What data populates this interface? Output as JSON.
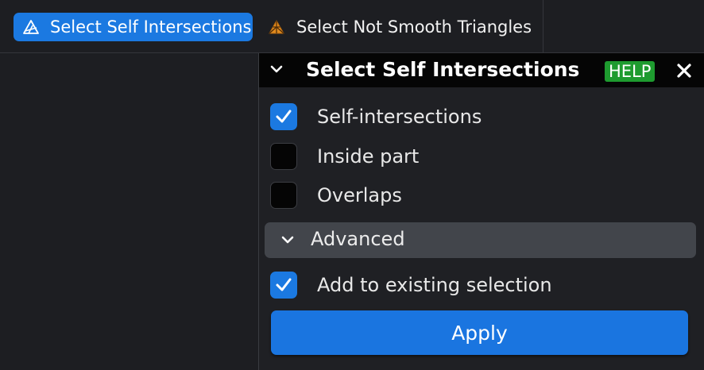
{
  "toolbar": {
    "tools": [
      {
        "label": "Select Self Intersections",
        "icon": "self-intersections-icon",
        "active": true
      },
      {
        "label": "Select Not Smooth Triangles",
        "icon": "not-smooth-triangles-icon",
        "active": false
      }
    ]
  },
  "panel": {
    "title": "Select Self Intersections",
    "help_label": "HELP",
    "options": [
      {
        "label": "Self-intersections",
        "checked": true
      },
      {
        "label": "Inside part",
        "checked": false
      },
      {
        "label": "Overlaps",
        "checked": false
      }
    ],
    "advanced": {
      "label": "Advanced",
      "expanded": false
    },
    "add_to_selection": {
      "label": "Add to existing selection",
      "checked": true
    },
    "apply_label": "Apply"
  },
  "colors": {
    "accent": "#1b79e1",
    "help_badge": "#1e9b2f",
    "background": "#1d1e22",
    "header": "#050505"
  }
}
